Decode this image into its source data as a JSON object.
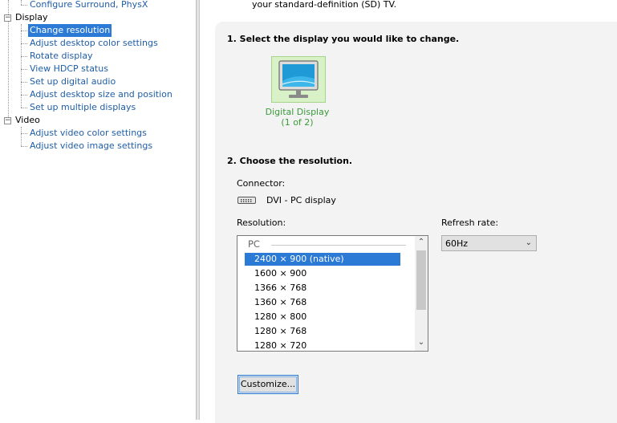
{
  "tree": {
    "items": [
      {
        "label": "Configure Surround, PhysX"
      },
      {
        "label": "Display"
      },
      {
        "label": "Change resolution"
      },
      {
        "label": "Adjust desktop color settings"
      },
      {
        "label": "Rotate display"
      },
      {
        "label": "View HDCP status"
      },
      {
        "label": "Set up digital audio"
      },
      {
        "label": "Adjust desktop size and position"
      },
      {
        "label": "Set up multiple displays"
      },
      {
        "label": "Video"
      },
      {
        "label": "Adjust video color settings"
      },
      {
        "label": "Adjust video image settings"
      }
    ],
    "selected": "Change resolution"
  },
  "intro_text": "your standard-definition (SD) TV.",
  "section1": {
    "title": "1. Select the display you would like to change.",
    "display_name": "Digital Display",
    "display_index": "(1 of 2)"
  },
  "section2": {
    "title": "2. Choose the resolution.",
    "connector_label": "Connector:",
    "connector_value": "DVI - PC display",
    "resolution_label": "Resolution:",
    "refresh_label": "Refresh rate:",
    "refresh_value": "60Hz",
    "resolution_group": "PC",
    "resolutions": [
      "2400 × 900 (native)",
      "1600 × 900",
      "1366 × 768",
      "1360 × 768",
      "1280 × 800",
      "1280 × 768",
      "1280 × 720"
    ],
    "selected_resolution": "2400 × 900 (native)",
    "customize_label": "Customize..."
  },
  "icons": [
    "monitor-icon",
    "dvi-connector-icon",
    "chevron-down-icon",
    "scroll-up-icon",
    "scroll-down-icon",
    "expander-minus-icon"
  ],
  "colors": {
    "link": "#1f5ea8",
    "selection": "#2b7ad6",
    "display_caption": "#3a9a3a",
    "display_tile": "#d9f1c6",
    "panel": "#f3f3f3"
  }
}
